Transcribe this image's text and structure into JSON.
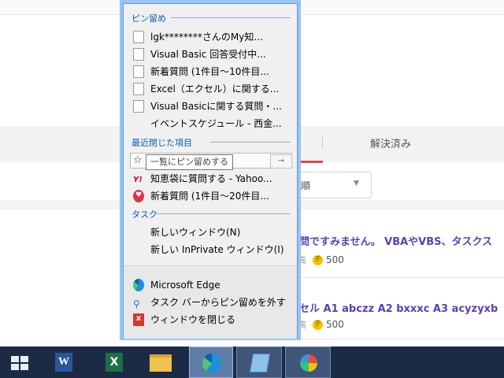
{
  "background_page": {
    "tab_resolved": "解決済み",
    "sort_label": "い順",
    "questions": [
      {
        "title": "問ですみません。 VBAやVBS、タスクス",
        "meta_prefix": "高",
        "coins": "500"
      },
      {
        "title": "セル A1 abczz A2 bxxxc A3 acyzyxb",
        "meta_prefix": "高",
        "coins": "500"
      }
    ]
  },
  "jump_list": {
    "pinned_header": "ピン留め",
    "pinned_items": [
      {
        "label": "lgk********さんのMy知...",
        "icon": "document-icon"
      },
      {
        "label": "Visual Basic 回答受付中...",
        "icon": "document-icon"
      },
      {
        "label": "新着質問 (1件目～10件目...",
        "icon": "document-icon"
      },
      {
        "label": "Excel（エクセル）に関する...",
        "icon": "document-icon"
      },
      {
        "label": "Visual Basicに関する質問・...",
        "icon": "document-icon"
      },
      {
        "label": "イベントスケジュール - 西金...",
        "icon": "none"
      }
    ],
    "recent_header": "最近閉じた項目",
    "recent_items": [
      {
        "label": "",
        "icon": "star-icon"
      },
      {
        "label": "知恵袋に質問する - Yahoo...",
        "icon": "yahoo-icon",
        "icon_text": "Y!"
      },
      {
        "label": "新着質問 (1件目～20件目...",
        "icon": "heart-icon"
      }
    ],
    "tooltip": "一覧にピン留めする",
    "tasks_header": "タスク",
    "task_items": [
      "新しいウィンドウ(N)",
      "新しい InPrivate ウィンドウ(I)"
    ],
    "app_items": [
      {
        "label": "Microsoft Edge",
        "icon": "edge-icon"
      },
      {
        "label": "タスク バーからピン留めを外す",
        "icon": "unpin-icon"
      },
      {
        "label": "ウィンドウを閉じる",
        "icon": "close-icon",
        "icon_text": "x"
      }
    ]
  },
  "taskbar": {
    "word_letter": "W",
    "excel_letter": "X",
    "apps": [
      "start-icon",
      "word-icon",
      "excel-icon",
      "file-explorer-icon",
      "edge-icon",
      "notepad-icon",
      "paint-icon"
    ]
  },
  "colors": {
    "accent": "#0b5cad",
    "taskbar": "#1b2b45",
    "question_link": "#5a3fb5"
  }
}
